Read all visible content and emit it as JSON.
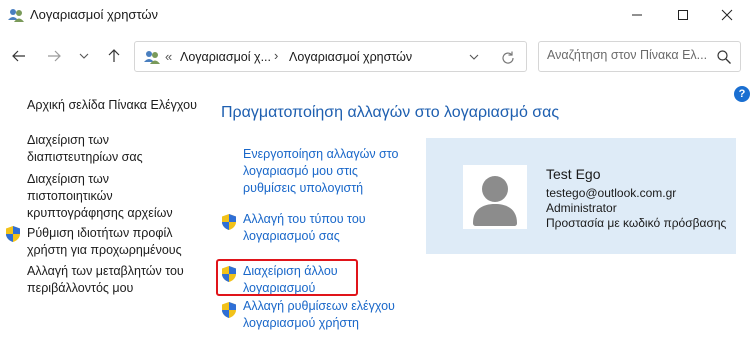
{
  "window": {
    "title": "Λογαριασμοί χρηστών",
    "icon": "users-icon"
  },
  "address": {
    "lt": "«",
    "crumb1": "Λογαριασμοί χ...",
    "separator": "›",
    "crumb2": "Λογαριασμοί χρηστών"
  },
  "search": {
    "placeholder": "Αναζήτηση στον Πίνακα Ελ..."
  },
  "help": {
    "label": "?"
  },
  "sidebar": {
    "home": "Αρχική σελίδα Πίνακα Ελέγχου",
    "items": [
      {
        "label": "Διαχείριση των διαπιστευτηρίων σας",
        "icon": ""
      },
      {
        "label": "Διαχείριση των πιστοποιητικών κρυπτογράφησης αρχείων",
        "icon": ""
      },
      {
        "label": "Ρύθμιση ιδιοτήτων προφίλ χρήστη για προχωρημένους",
        "icon": "uac-shield-icon"
      },
      {
        "label": "Αλλαγή των μεταβλητών του περιβάλλοντός μου",
        "icon": ""
      }
    ]
  },
  "main": {
    "title": "Πραγματοποίηση αλλαγών στο λογαριασμό σας",
    "tasks": [
      {
        "label": "Ενεργοποίηση αλλαγών στο λογαριασμό μου στις ρυθμίσεις υπολογιστή",
        "icon": ""
      },
      {
        "label": "Αλλαγή του τύπου του λογαριασμού σας",
        "icon": "uac-shield-icon"
      },
      {
        "label": "Διαχείριση άλλου λογαριασμού",
        "icon": "uac-shield-icon",
        "highlighted": true
      },
      {
        "label": "Αλλαγή ρυθμίσεων ελέγχου λογαριασμού χρήστη",
        "icon": "uac-shield-icon"
      }
    ]
  },
  "account": {
    "name": "Test Ego",
    "email": "testego@outlook.com.gr",
    "role": "Administrator",
    "protection": "Προστασία με κωδικό πρόσβασης"
  },
  "colors": {
    "link": "#1967c9",
    "title": "#1e5fb0",
    "card": "#deebf7",
    "highlight": "#e0141a"
  }
}
